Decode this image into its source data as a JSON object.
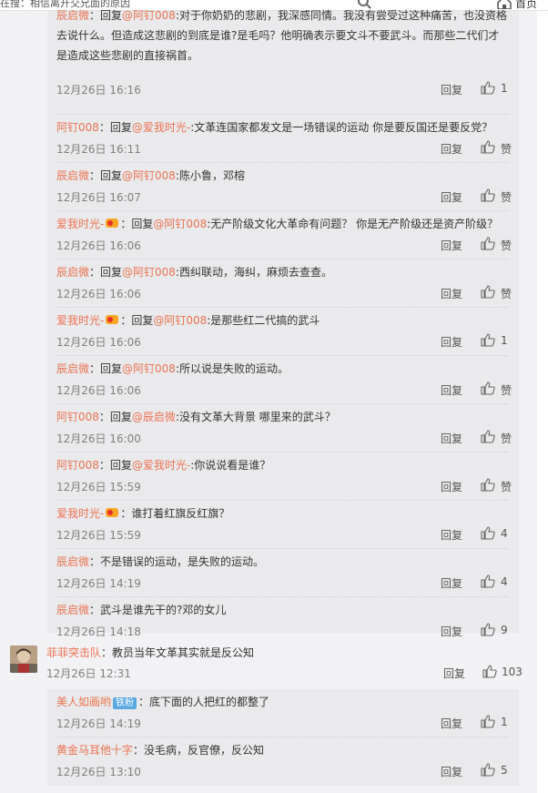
{
  "topbar": {
    "search_text": "在搜：相信离开交兄面的原因",
    "home_label": "首页"
  },
  "thread1": [
    {
      "user": "辰启微",
      "prefix": "：回复",
      "at": "@阿钉008",
      "text": ":对于你奶奶的悲剧，我深感同情。我没有尝受过这种痛苦，也没资格去说什么。但造成这悲剧的到底是谁?是毛吗？他明确表示要文斗不要武斗。而那些二代们才是造成这些悲剧的直接祸首。",
      "time": "12月26日 16:16",
      "reply": "回复",
      "likes": "1"
    },
    {
      "user": "阿钉008",
      "prefix": "：回复",
      "at": "@爱我时光-",
      "text": ":文革连国家都发文是一场错误的运动 你是要反国还是要反党？",
      "time": "12月26日 16:11",
      "reply": "回复",
      "likes": "赞"
    },
    {
      "user": "辰启微",
      "prefix": "：回复",
      "at": "@阿钉008",
      "text": ":陈小鲁，邓榕",
      "time": "12月26日 16:07",
      "reply": "回复",
      "likes": "赞"
    },
    {
      "user": "爱我时光-",
      "vip": true,
      "prefix": "：回复",
      "at": "@阿钉008",
      "text": ":无产阶级文化大革命有问题？ 你是无产阶级还是资产阶级？",
      "time": "12月26日 16:06",
      "reply": "回复",
      "likes": "赞"
    },
    {
      "user": "辰启微",
      "prefix": "：回复",
      "at": "@阿钉008",
      "text": ":西纠联动，海纠，麻烦去查查。",
      "time": "12月26日 16:06",
      "reply": "回复",
      "likes": "赞"
    },
    {
      "user": "爱我时光-",
      "vip": true,
      "prefix": "：回复",
      "at": "@阿钉008",
      "text": ":是那些红二代搞的武斗",
      "time": "12月26日 16:06",
      "reply": "回复",
      "likes": "1"
    },
    {
      "user": "辰启微",
      "prefix": "：回复",
      "at": "@阿钉008",
      "text": ":所以说是失败的运动。",
      "time": "12月26日 16:06",
      "reply": "回复",
      "likes": "赞"
    },
    {
      "user": "阿钉008",
      "prefix": "：回复",
      "at": "@辰启微",
      "text": ":没有文革大背景 哪里来的武斗？",
      "time": "12月26日 16:00",
      "reply": "回复",
      "likes": "赞"
    },
    {
      "user": "阿钉008",
      "prefix": "：回复",
      "at": "@爱我时光-",
      "text": ":你说说看是谁？",
      "time": "12月26日 15:59",
      "reply": "回复",
      "likes": "赞"
    },
    {
      "user": "爱我时光-",
      "vip": true,
      "prefix": "：",
      "at": "",
      "text": "谁打着红旗反红旗？",
      "time": "12月26日 15:59",
      "reply": "回复",
      "likes": "4"
    },
    {
      "user": "辰启微",
      "prefix": "：",
      "at": "",
      "text": "不是错误的运动，是失败的运动。",
      "time": "12月26日 14:19",
      "reply": "回复",
      "likes": "4"
    },
    {
      "user": "辰启微",
      "prefix": "：",
      "at": "",
      "text": "武斗是谁先干的?邓的女儿",
      "time": "12月26日 14:18",
      "reply": "回复",
      "likes": "9"
    }
  ],
  "main_comment": {
    "user": "菲菲突击队",
    "text": "：教员当年文革其实就是反公知",
    "time": "12月26日 12:31",
    "reply": "回复",
    "likes": "103"
  },
  "thread2": [
    {
      "user": "美人如画哟",
      "badge": "铁粉",
      "prefix": "：",
      "at": "",
      "text": "底下面的人把红的都整了",
      "time": "12月26日 14:19",
      "reply": "回复",
      "likes": "1"
    },
    {
      "user": "黄金马耳他十字",
      "prefix": "：",
      "at": "",
      "text": "没毛病，反官僚，反公知",
      "time": "12月26日 13:10",
      "reply": "回复",
      "likes": "5"
    }
  ]
}
